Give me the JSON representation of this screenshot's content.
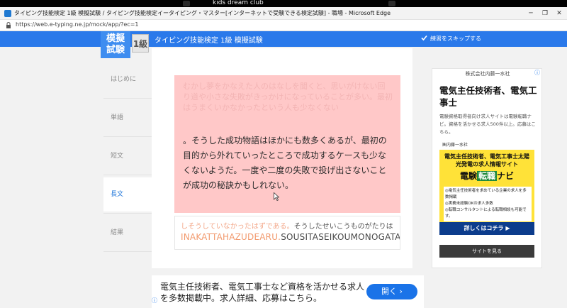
{
  "zoom_meeting": {
    "label": "kids dream club"
  },
  "window": {
    "title": "タイピング技能検定 1級 模擬試験 / タイピング技能検定イータイピング・マスター[インターネットで受験できる検定試験] - 職場 - Microsoft Edge",
    "minimize": "─",
    "maximize": "❐",
    "close": "✕"
  },
  "address": {
    "url": "https://web.e-typing.ne.jp/mock/app/?ec=1"
  },
  "topnav": {
    "logo_line1": "模擬",
    "logo_line2": "試験",
    "level_badge": "1級",
    "title": "タイピング技能検定 1級 模擬試験",
    "skip_label": "練習をスキップする"
  },
  "sidebar": {
    "items": [
      {
        "label": "はじめに"
      },
      {
        "label": "単語"
      },
      {
        "label": "短文"
      },
      {
        "label": "長文"
      },
      {
        "label": "結果"
      }
    ]
  },
  "exercise": {
    "faded_text": "むかし夢をかなえた人のはなしを聞くと、思いがけない回り道や小さな失敗がきっかけになっていることが多い。最初はうまくいかなかったという人も少なくない",
    "typed_text": "。そうした成功物語はほかにも数多くあるが、最初の目的から外れていったところで成功するケースも少なくないようだ。一度や二度の失敗で投げ出さないことが成功の秘訣かもしれない。",
    "kana_done": "しそうしていなかったはずである。",
    "kana_rest": "そうしたせいこうものがたりは",
    "roma_done": "INAKATTAHAZUDEARU.",
    "roma_rest": "SOUSITASEIKOUMONOGATARIHA"
  },
  "side_ad": {
    "company": "株式会社内藤一水社",
    "headline": "電気主任技術者、電気工事士",
    "description": "電験資格取得者向け求人サイトは電験転職ナビ。資格を活かせる求人500件以上。応募はこちら。",
    "banner_top": "㈱内藤一水社",
    "banner_title": "電気主任技術者、電気工事士太陽光発電の求人情報サイト",
    "banner_logo_a": "電験",
    "banner_logo_b": "転職",
    "banner_logo_c": "ナビ",
    "banner_list": [
      "◎電気主任技術者を求めている企業の求人を多数掲載",
      "◎実務未経験OKの求人多数",
      "◎転職コンサルタントによる転職相談も可能です。"
    ],
    "banner_cta": "詳しくはコチラ ▶",
    "site_button": "サイトを見る"
  },
  "bottom_ad": {
    "text": "電気主任技術者、電気工事士など資格を活かせる求人を多数掲載中。求人詳細、応募はこちら。",
    "button": "開く ›"
  }
}
